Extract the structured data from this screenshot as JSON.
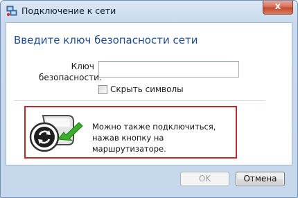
{
  "window": {
    "title": "Подключение к сети",
    "close_label": "x"
  },
  "main": {
    "heading": "Введите ключ безопасности сети",
    "key_label": "Ключ\nбезопасности:",
    "key_input": {
      "value": "",
      "placeholder": ""
    },
    "hide_symbols_label": "Скрыть символы",
    "hide_symbols_checked": false,
    "router_hint": "Можно также подключиться, нажав кнопку на маршрутизаторе."
  },
  "footer": {
    "ok_label": "OK",
    "ok_enabled": false,
    "cancel_label": "Отмена"
  },
  "colors": {
    "heading": "#1e4c92",
    "highlight_border": "#c0282e",
    "arrow_green": "#3cae2c"
  }
}
